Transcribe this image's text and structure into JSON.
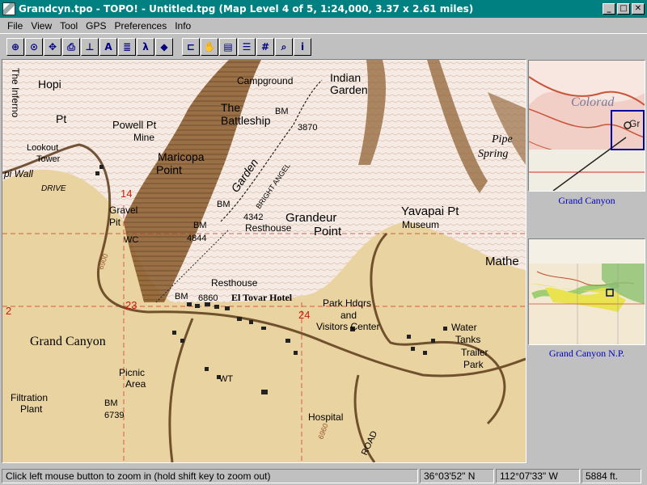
{
  "window": {
    "title": "Grandcyn.tpo - TOPO! - Untitled.tpg   (Map Level 4 of 5, 1:24,000, 3.37 x 2.61 miles)",
    "minimize": "_",
    "maximize": "□",
    "close": "✕"
  },
  "menu": [
    "File",
    "View",
    "Tool",
    "GPS",
    "Preferences",
    "Info"
  ],
  "toolbar": {
    "icons": [
      {
        "name": "zoom-in-icon",
        "glyph": "⊕"
      },
      {
        "name": "crosshair-icon",
        "glyph": "⊙"
      },
      {
        "name": "pan-icon",
        "glyph": "✥"
      },
      {
        "name": "print-icon",
        "glyph": "⎙"
      },
      {
        "name": "pushpin-icon",
        "glyph": "⊥"
      },
      {
        "name": "text-tool-icon",
        "glyph": "A"
      },
      {
        "name": "notes-icon",
        "glyph": "≣"
      },
      {
        "name": "hiker-icon",
        "glyph": "λ"
      },
      {
        "name": "waypoint-icon",
        "glyph": "◆"
      },
      {
        "name": "open-folder-icon",
        "glyph": "⊏"
      },
      {
        "name": "hand-icon",
        "glyph": "✋"
      },
      {
        "name": "layers-icon",
        "glyph": "▤"
      },
      {
        "name": "list-icon",
        "glyph": "☰"
      },
      {
        "name": "grid-icon",
        "glyph": "#"
      },
      {
        "name": "magnifier-icon",
        "glyph": "⌕"
      },
      {
        "name": "info-icon",
        "glyph": "i"
      }
    ]
  },
  "map": {
    "labels": {
      "inferno": "The Inferno",
      "hopi": "Hopi",
      "pt": "Pt",
      "lookout": "Lookout",
      "tower": "Tower",
      "powell": "Powell Pt",
      "mine": "Mine",
      "maricopa": "Maricopa",
      "point": "Point",
      "pi_wall": "pi Wall",
      "drive": "DRIVE",
      "campground": "Campground",
      "indian": "Indian",
      "garden_place": "Garden",
      "the": "The",
      "battleship": "Battleship",
      "bm": "BM",
      "bm3870": "3870",
      "garden_trail": "Garden",
      "bright_angel": "BRIGHT ANGEL",
      "pipe": "Pipe",
      "spring": "Spring",
      "sec14": "14",
      "gravel": "Gravel",
      "gravel_pit": "Pit",
      "wc": "WC",
      "bm4844": "4844",
      "bm4342": "4342",
      "resthouse1": "Resthouse",
      "grandeur": "Grandeur",
      "grandeur_point": "Point",
      "yavapai": "Yavapai Pt",
      "museum": "Museum",
      "mather": "Mathe",
      "resthouse2": "Resthouse",
      "sec23": "23",
      "bm6860": "6860",
      "el_tovar": "El Tovar Hotel",
      "park_hdqrs": "Park Hdqrs",
      "and": "and",
      "visitors": "Visitors Center",
      "sec24": "24",
      "water": "Water",
      "tanks": "Tanks",
      "trailer": "Trailer",
      "park": "Park",
      "two": "2",
      "grand_canyon": "Grand Canyon",
      "picnic": "Picnic",
      "area": "Area",
      "wt": "WT",
      "filtration": "Filtration",
      "plant": "Plant",
      "bm6739": "6739",
      "hospital": "Hospital",
      "road": "ROAD",
      "c6960": "6960",
      "c6900": "6900"
    }
  },
  "overview": {
    "top_label": "Colorad",
    "top_edge_label": "Gr",
    "top_caption": "Grand Canyon",
    "bottom_caption": "Grand Canyon N.P."
  },
  "status": {
    "message": "Click left mouse button to zoom in (hold shift key to zoom out)",
    "latitude": "36°03'52\" N",
    "longitude": "112°07'33\" W",
    "elevation": "5884 ft."
  }
}
